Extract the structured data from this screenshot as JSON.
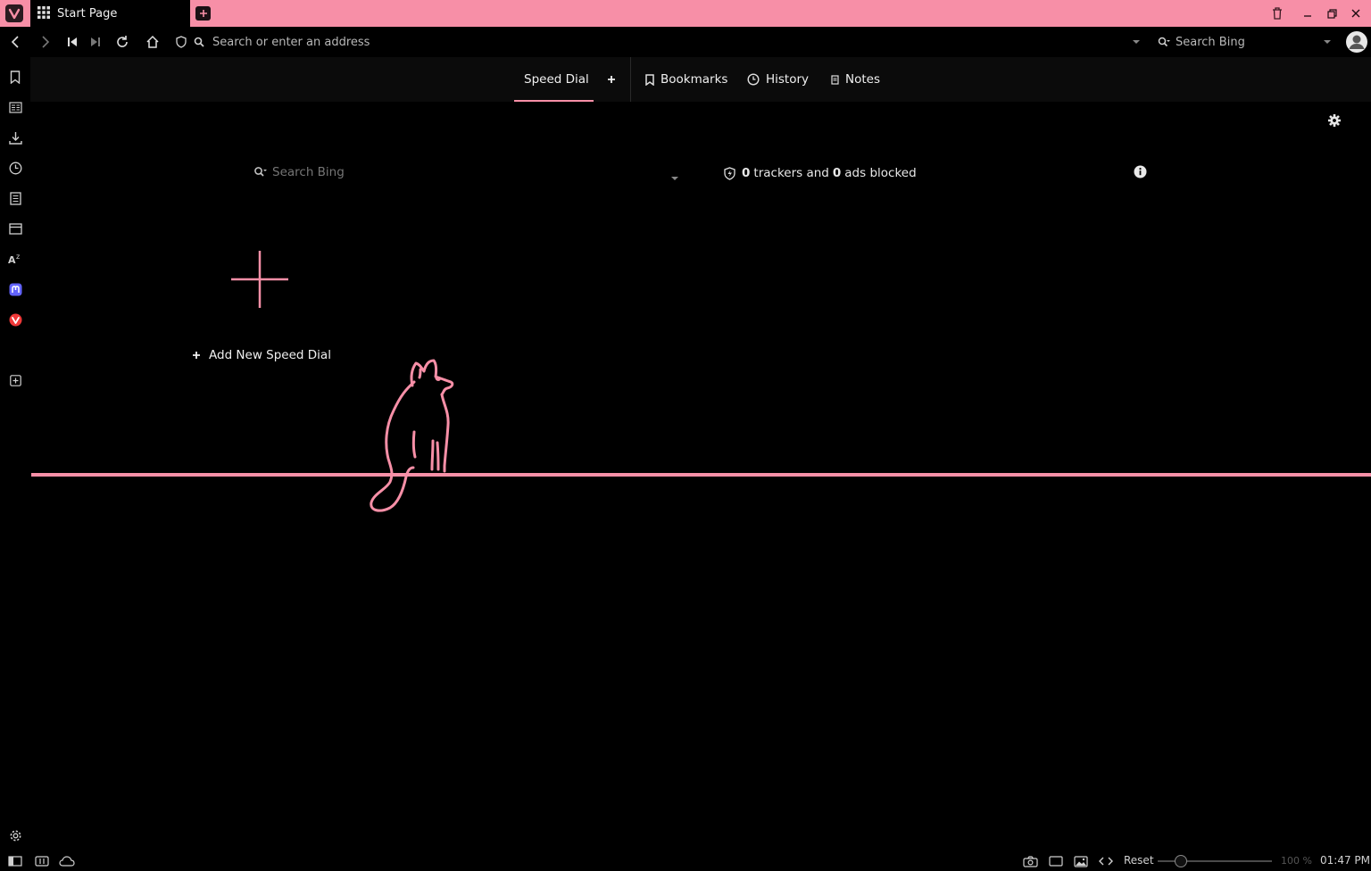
{
  "colors": {
    "accent": "#f78fa7",
    "background": "#000000",
    "header": "#0b0b0b"
  },
  "tab": {
    "title": "Start Page"
  },
  "address_bar": {
    "url_placeholder": "Search or enter an address",
    "search_placeholder": "Search Bing"
  },
  "start_page": {
    "tabs": [
      {
        "label": "Speed Dial",
        "icon": "none"
      },
      {
        "label": "Bookmarks",
        "icon": "bookmark-icon"
      },
      {
        "label": "History",
        "icon": "clock-icon"
      },
      {
        "label": "Notes",
        "icon": "note-icon"
      }
    ],
    "search_placeholder": "Search Bing",
    "trackers_count": "0",
    "trackers_text": "trackers and",
    "ads_count": "0",
    "ads_text": "ads blocked",
    "add_speed_dial_label": "Add New Speed Dial"
  },
  "sidebar": {
    "items": [
      "bookmark-icon",
      "reading-list-icon",
      "download-icon",
      "history-icon",
      "notes-icon",
      "window-icon",
      "translate-icon",
      "mastodon-icon",
      "vivaldi-icon",
      "add-panel-icon"
    ]
  },
  "status_bar": {
    "reset_label": "Reset",
    "zoom_level": "100 %",
    "clock": "01:47 PM"
  }
}
